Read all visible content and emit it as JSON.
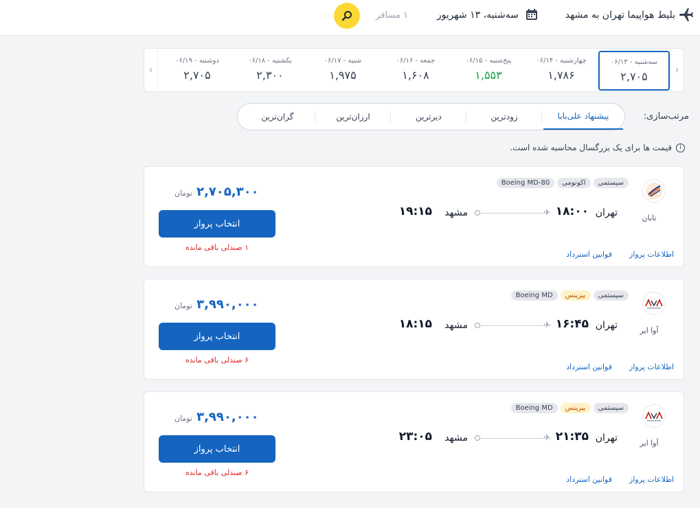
{
  "header": {
    "route": "بلیط هواپیما تهران به مشهد",
    "date": "سه‌شنبه، ۱۳ شهریور",
    "passengers": "۱ مسافر"
  },
  "date_strip": [
    {
      "label": "سه‌شنبه - ۰۶/۱۳",
      "price": "۲,۷۰۵",
      "active": true
    },
    {
      "label": "چهارشنبه - ۰۶/۱۴",
      "price": "۱,۷۸۶"
    },
    {
      "label": "پنج‌شنبه - ۰۶/۱۵",
      "price": "۱,۵۵۳",
      "cheapest": true
    },
    {
      "label": "جمعه - ۰۶/۱۶",
      "price": "۱,۶۰۸"
    },
    {
      "label": "شنبه - ۰۶/۱۷",
      "price": "۱,۹۷۵"
    },
    {
      "label": "یکشنبه - ۰۶/۱۸",
      "price": "۲,۳۰۰"
    },
    {
      "label": "دوشنبه - ۰۶/۱۹",
      "price": "۲,۷۰۵"
    }
  ],
  "sort": {
    "label": "مرتب‌سازی:",
    "options": [
      "پیشنهاد علی‌بابا",
      "زودترین",
      "دیرترین",
      "ارزان‌ترین",
      "گران‌ترین"
    ],
    "active": 0
  },
  "notice": "قیمت ها برای یک بزرگسال محاسبه شده است.",
  "flights": [
    {
      "airline": "تابان",
      "badges": [
        {
          "text": "سیستمی",
          "type": "default"
        },
        {
          "text": "اکونومی",
          "type": "default"
        },
        {
          "text": "Boeing MD-80",
          "type": "default"
        }
      ],
      "origin": "تهران",
      "dep_time": "۱۸:۰۰",
      "destination": "مشهد",
      "arr_time": "۱۹:۱۵",
      "price": "۲,۷۰۵,۳۰۰",
      "currency": "تومان",
      "button": "انتخاب پرواز",
      "seats": "۱ صندلی باقی مانده",
      "info_link": "اطلاعات پرواز",
      "rules_link": "قوانین استرداد"
    },
    {
      "airline": "آوا ایر",
      "badges": [
        {
          "text": "سیستمی",
          "type": "default"
        },
        {
          "text": "بیزینس",
          "type": "business"
        },
        {
          "text": "Boeing MD",
          "type": "default"
        }
      ],
      "origin": "تهران",
      "dep_time": "۱۶:۴۵",
      "destination": "مشهد",
      "arr_time": "۱۸:۱۵",
      "price": "۳,۹۹۰,۰۰۰",
      "currency": "تومان",
      "button": "انتخاب پرواز",
      "seats": "۶ صندلی باقی مانده",
      "info_link": "اطلاعات پرواز",
      "rules_link": "قوانین استرداد"
    },
    {
      "airline": "آوا ایر",
      "badges": [
        {
          "text": "سیستمی",
          "type": "default"
        },
        {
          "text": "بیزینس",
          "type": "business"
        },
        {
          "text": "Boeing MD",
          "type": "default"
        }
      ],
      "origin": "تهران",
      "dep_time": "۲۱:۳۵",
      "destination": "مشهد",
      "arr_time": "۲۳:۰۵",
      "price": "۳,۹۹۰,۰۰۰",
      "currency": "تومان",
      "button": "انتخاب پرواز",
      "seats": "۶ صندلی باقی مانده",
      "info_link": "اطلاعات پرواز",
      "rules_link": "قوانین استرداد"
    }
  ],
  "colors": {
    "primary": "#1565c0",
    "accent_yellow": "#fdd835",
    "cheapest": "#16a34a",
    "warning": "#dc2626"
  },
  "icons": [
    "airplane-icon",
    "calendar-icon",
    "search-icon",
    "info-icon",
    "taban-logo",
    "ava-air-logo"
  ]
}
